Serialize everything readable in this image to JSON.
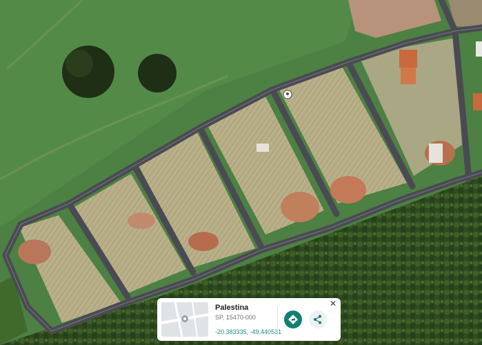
{
  "place": {
    "name": "Palestina",
    "address": "SP, 15470-000",
    "coordinates": "-20.383335, -49.440531"
  },
  "icons": {
    "close": "close-icon",
    "directions": "directions-icon",
    "share": "share-icon",
    "pin": "location-pin-icon"
  },
  "colors": {
    "accent": "#127f72",
    "coordinates_text": "#1a8a7d",
    "road": "#4a4b52"
  }
}
